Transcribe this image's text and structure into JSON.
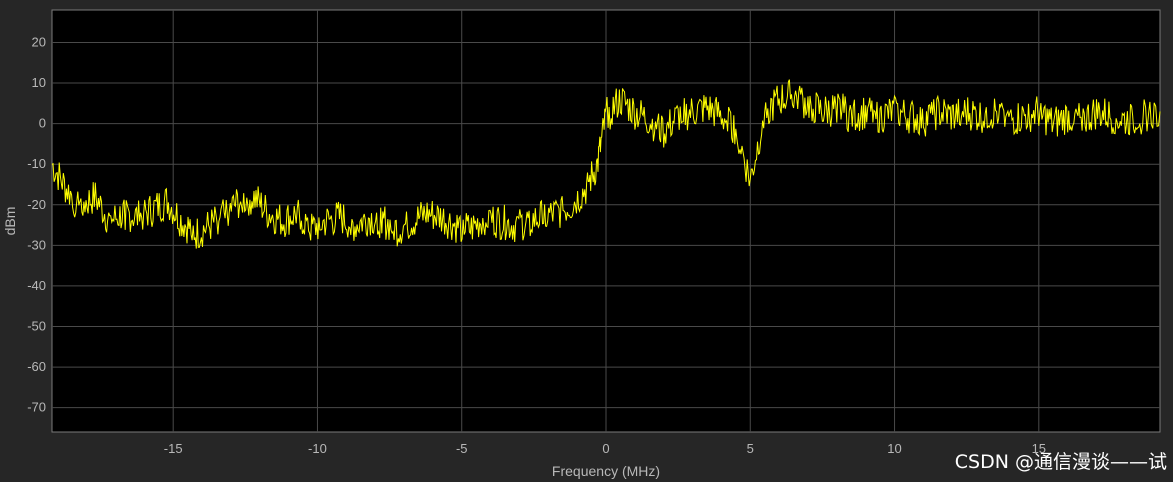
{
  "chart_data": {
    "type": "line",
    "title": "",
    "xlabel": "Frequency (MHz)",
    "ylabel": "dBm",
    "xlim": [
      -19.2,
      19.2
    ],
    "ylim": [
      -76,
      28
    ],
    "xticks": [
      -15,
      -10,
      -5,
      0,
      5,
      10,
      15
    ],
    "yticks": [
      20,
      10,
      0,
      -10,
      -20,
      -30,
      -40,
      -50,
      -60,
      -70
    ],
    "xtick_labels": [
      "-15",
      "-10",
      "-5",
      "0",
      "5",
      "10",
      "15"
    ],
    "ytick_labels": [
      "20",
      "10",
      "0",
      "-10",
      "-20",
      "-30",
      "-40",
      "-50",
      "-60",
      "-70"
    ],
    "grid": true,
    "background_color": "#000000",
    "figure_color": "#262626",
    "grid_color": "#4a4a4a",
    "series": [
      {
        "color": "#ffff00",
        "x": [
          -19.2,
          -18.7,
          -18.2,
          -17.7,
          -17.2,
          -16.7,
          -16.2,
          -15.7,
          -15.2,
          -14.7,
          -14.2,
          -13.7,
          -13.2,
          -12.7,
          -12.2,
          -11.7,
          -11.2,
          -10.7,
          -10.2,
          -9.7,
          -9.2,
          -8.7,
          -8.2,
          -7.7,
          -7.2,
          -6.7,
          -6.2,
          -5.7,
          -5.2,
          -4.7,
          -4.2,
          -3.7,
          -3.2,
          -2.7,
          -2.2,
          -1.7,
          -1.2,
          -0.7,
          -0.3,
          0.0,
          0.5,
          1.0,
          1.5,
          2.0,
          2.5,
          3.0,
          3.5,
          4.0,
          4.5,
          5.0,
          5.5,
          6.0,
          6.5,
          7.0,
          7.5,
          8.0,
          8.5,
          9.0,
          9.5,
          10.0,
          10.5,
          11.0,
          11.5,
          12.0,
          12.5,
          13.0,
          13.5,
          14.0,
          14.5,
          15.0,
          15.5,
          16.0,
          16.5,
          17.0,
          17.5,
          18.0,
          18.5,
          19.2
        ],
        "y": [
          -10,
          -16,
          -20,
          -18,
          -24,
          -22,
          -23,
          -21,
          -19,
          -24,
          -27,
          -25,
          -22,
          -19,
          -18,
          -22,
          -24,
          -22,
          -26,
          -24,
          -23,
          -25,
          -23,
          -24,
          -26,
          -24,
          -22,
          -23,
          -25,
          -26,
          -23,
          -24,
          -25,
          -24,
          -23,
          -22,
          -20,
          -16,
          -10,
          2,
          6,
          3,
          1,
          -2,
          2,
          3,
          4,
          2,
          -1,
          -14,
          3,
          6,
          7,
          5,
          3,
          4,
          2,
          3,
          2,
          3,
          2,
          1,
          3,
          2,
          3,
          2,
          3,
          1,
          2,
          3,
          0,
          2,
          1,
          3,
          2,
          1,
          2,
          3
        ]
      }
    ]
  },
  "watermark": "CSDN @通信漫谈——试"
}
